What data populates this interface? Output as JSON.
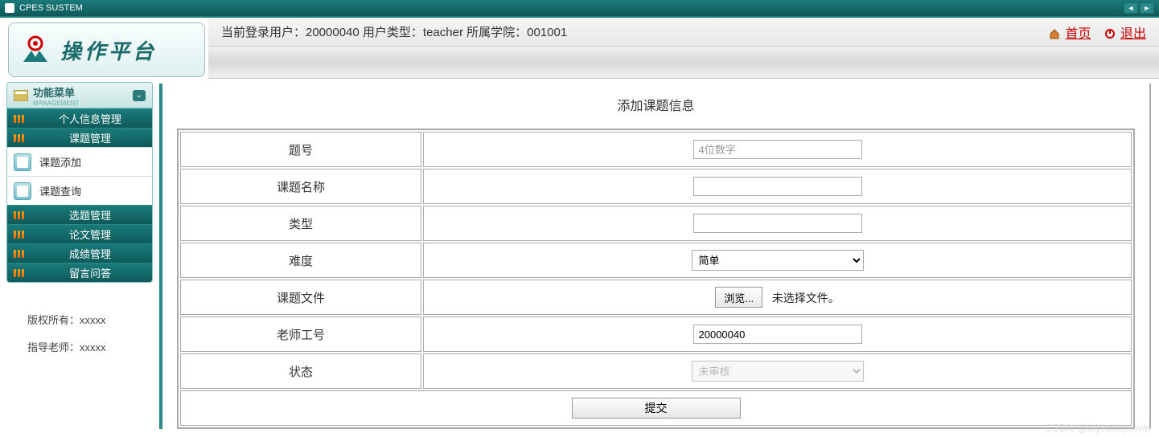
{
  "titlebar": {
    "title": "CPES SUSTEM"
  },
  "logo": {
    "text": "操作平台"
  },
  "header": {
    "info": "当前登录用户：20000040   用户类型：teacher   所属学院：001001",
    "home_label": "首页",
    "exit_label": "退出"
  },
  "sidebar": {
    "menu_title": "功能菜单",
    "menu_subtitle": "MANAGEMENT",
    "items": [
      {
        "label": "个人信息管理",
        "type": "primary"
      },
      {
        "label": "课题管理",
        "type": "primary"
      },
      {
        "label": "课题添加",
        "type": "sub"
      },
      {
        "label": "课题查询",
        "type": "sub"
      },
      {
        "label": "选题管理",
        "type": "primary"
      },
      {
        "label": "论文管理",
        "type": "primary"
      },
      {
        "label": "成绩管理",
        "type": "primary"
      },
      {
        "label": "留言问答",
        "type": "primary"
      }
    ],
    "footer": {
      "copyright": "版权所有：xxxxx",
      "advisor": "指导老师：xxxxx"
    }
  },
  "content": {
    "title": "添加课题信息",
    "form": {
      "row0": {
        "label": "题号",
        "placeholder": "4位数字",
        "value": ""
      },
      "row1": {
        "label": "课题名称",
        "value": ""
      },
      "row2": {
        "label": "类型",
        "value": ""
      },
      "row3": {
        "label": "难度",
        "selected": "简单"
      },
      "row4": {
        "label": "课题文件",
        "browse": "浏览...",
        "status": "未选择文件。"
      },
      "row5": {
        "label": "老师工号",
        "value": "20000040"
      },
      "row6": {
        "label": "状态",
        "selected": "未审核"
      },
      "submit": "提交"
    }
  },
  "watermark": "CSDN @biyezuopinvip"
}
